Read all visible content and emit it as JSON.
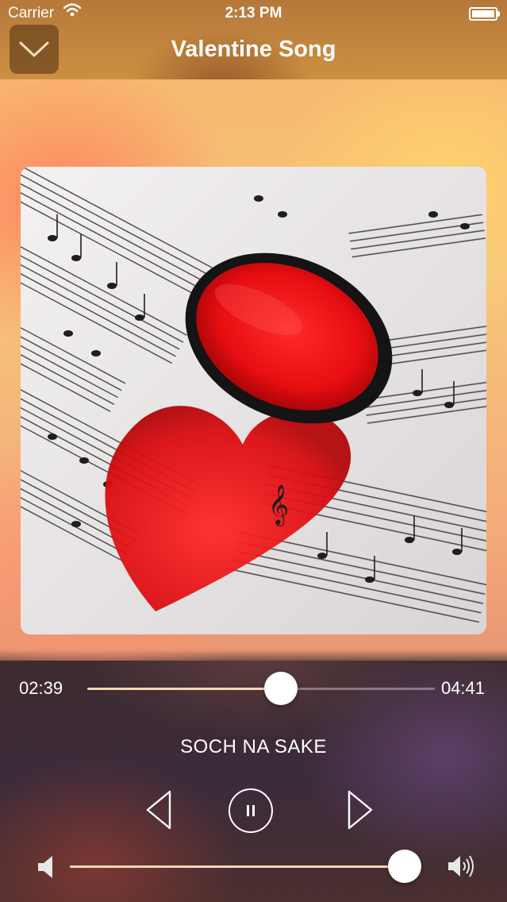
{
  "status_bar": {
    "carrier": "Carrier",
    "time": "2:13 PM",
    "battery_level": 1.0
  },
  "nav": {
    "title": "Valentine Song",
    "collapse_icon": "chevron-down-icon"
  },
  "artwork": {
    "icons": [
      "sheet-music",
      "red-lens",
      "heart-shadow"
    ]
  },
  "player": {
    "elapsed": "02:39",
    "total": "04:41",
    "progress": 0.557,
    "song_title": "SOCH NA SAKE",
    "state": "playing",
    "controls": {
      "prev_icon": "previous-track-icon",
      "play_icon": "pause-icon",
      "next_icon": "next-track-icon"
    },
    "volume": 0.96,
    "volume_icons": [
      "speaker-low-icon",
      "speaker-high-icon"
    ]
  },
  "colors": {
    "accent": "#ffffff",
    "track_fill": "#ffe1be",
    "nav_bg": "#b8783a"
  }
}
